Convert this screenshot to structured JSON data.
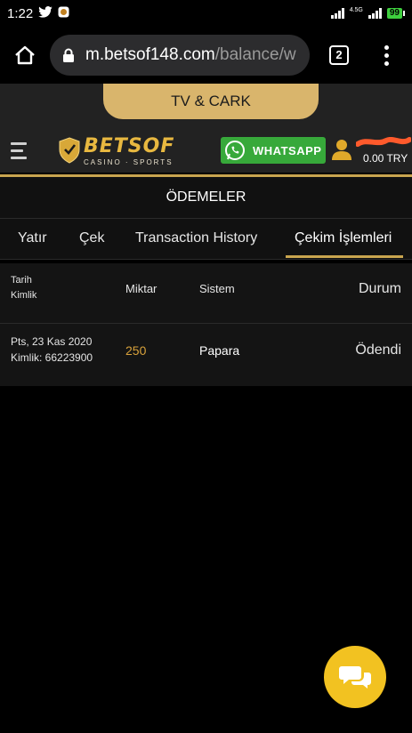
{
  "status_bar": {
    "time": "1:22",
    "network_tag": "4.5G",
    "battery": "99"
  },
  "browser": {
    "url_domain": "m.betsof148.com",
    "url_path": "/balance/w",
    "tab_count": "2"
  },
  "site": {
    "promo_tab": "TV & CARK",
    "logo_text": "BETSOF",
    "logo_tagline": "CASINO · SPORTS",
    "whatsapp_label": "WHATSAPP",
    "balance": "0.00 TRY",
    "accent_color": "#c9a54f",
    "whatsapp_color": "#37a93a"
  },
  "page": {
    "title": "ÖDEMELER"
  },
  "tabs": [
    {
      "label": "Yatır"
    },
    {
      "label": "Çek"
    },
    {
      "label": "Transaction History"
    },
    {
      "label": "Çekim İşlemleri",
      "active": true
    }
  ],
  "table": {
    "headers": {
      "date": "Tarih",
      "id": "Kimlik",
      "amount": "Miktar",
      "system": "Sistem",
      "status": "Durum"
    },
    "rows": [
      {
        "date": "Pts, 23 Kas 2020",
        "id": "Kimlik: 66223900",
        "amount": "250",
        "system": "Papara",
        "status": "Ödendi"
      }
    ]
  }
}
